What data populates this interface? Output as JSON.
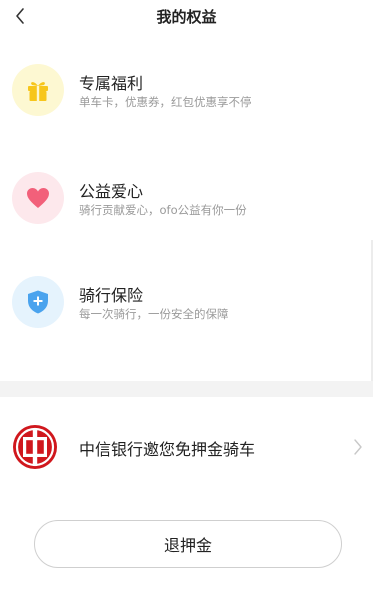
{
  "header": {
    "title": "我的权益"
  },
  "benefits": [
    {
      "name": "专属福利",
      "desc": "单车卡，优惠券，红包优惠享不停",
      "icon": "gift-icon",
      "bg": "#fdf8d2",
      "color": "#f7c61b"
    },
    {
      "name": "公益爱心",
      "desc": "骑行贡献爱心，ofo公益有你一份",
      "icon": "heart-icon",
      "bg": "#fde8ec",
      "color": "#f2607a"
    },
    {
      "name": "骑行保险",
      "desc": "每一次骑行，一份安全的保障",
      "icon": "shield-plus-icon",
      "bg": "#e5f3fd",
      "color": "#4aa3ee"
    }
  ],
  "bank": {
    "label": "中信银行邀您免押金骑车",
    "logo_color": "#d0171d"
  },
  "refund_button": {
    "label": "退押金"
  }
}
